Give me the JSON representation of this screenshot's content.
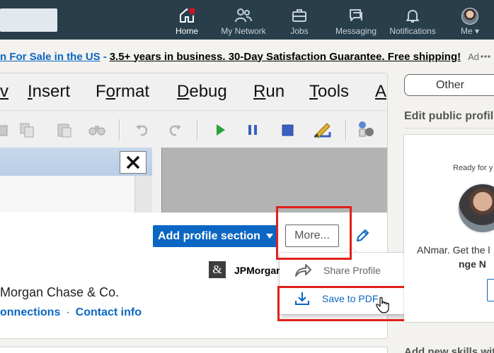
{
  "nav": {
    "items": [
      {
        "label": "Home",
        "icon": "home-icon"
      },
      {
        "label": "My Network",
        "icon": "network-icon"
      },
      {
        "label": "Jobs",
        "icon": "briefcase-icon"
      },
      {
        "label": "Messaging",
        "icon": "messaging-icon"
      },
      {
        "label": "Notifications",
        "icon": "bell-icon"
      },
      {
        "label": "Me",
        "icon": "avatar"
      }
    ]
  },
  "ad": {
    "link_text": "n For Sale in the US",
    "separator": "-",
    "text": "3.5+ years in business. 30-Day Satisfaction Guarantee. Free shipping!",
    "tag": "Ad"
  },
  "background_app": {
    "menu": [
      "v",
      "Insert",
      "Format",
      "Debug",
      "Run",
      "Tools",
      "A"
    ],
    "close_glyph": "✕"
  },
  "profile": {
    "add_section_label": "Add profile section",
    "more_label": "More...",
    "company_logo_glyph": "&",
    "company_short": "JPMorgan",
    "company_line": "Morgan Chase & Co.",
    "connections_label": "onnections",
    "contact_label": "Contact info",
    "dot": "·"
  },
  "dropdown": {
    "share_label": "Share Profile",
    "pdf_label": "Save to PDF"
  },
  "rail": {
    "other_label": "Other",
    "edit_public_label": "Edit public profile",
    "ready_text": "Ready for y",
    "line1": "ANmar. Get the l",
    "line2": "nge N",
    "add_skills": "Add new skills with"
  },
  "colors": {
    "nav_bg": "#283e4a",
    "brand_blue": "#0a66c2",
    "highlight_red": "#e0201a"
  }
}
